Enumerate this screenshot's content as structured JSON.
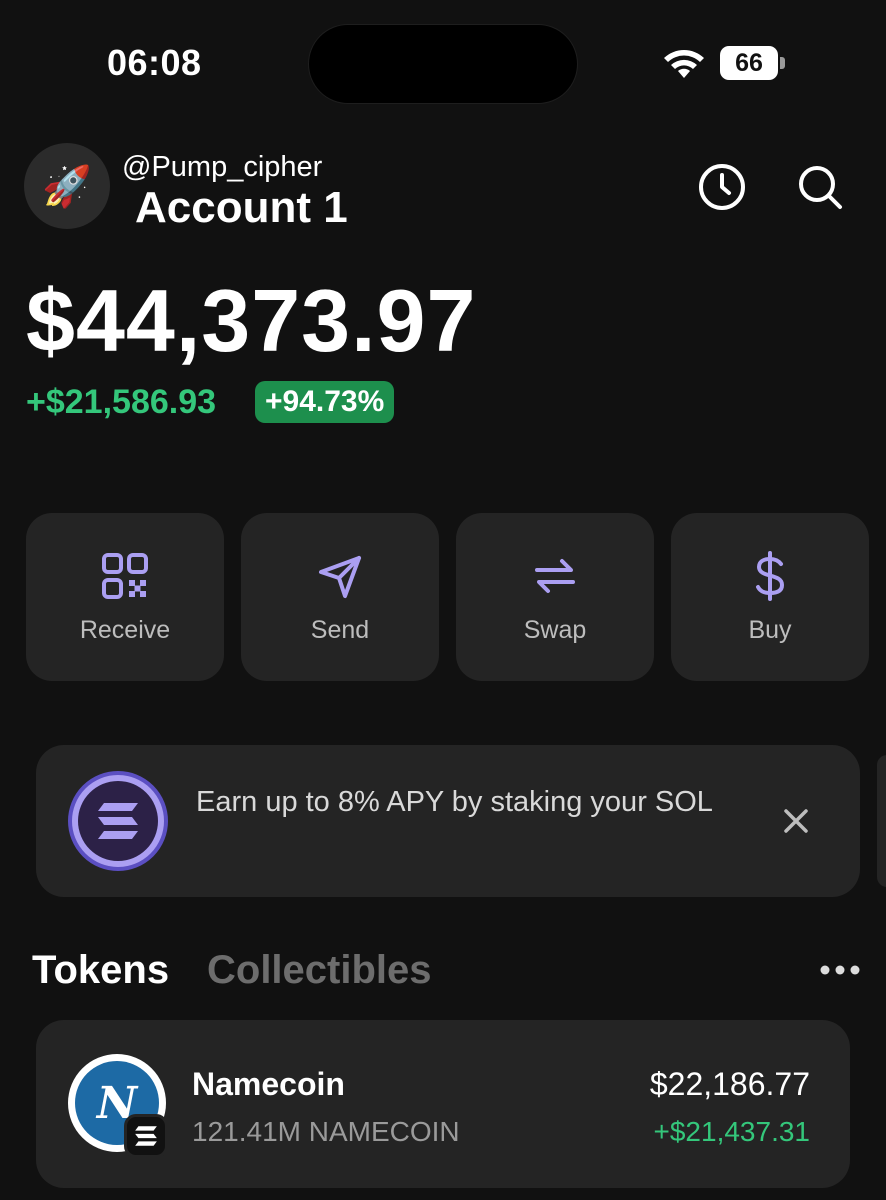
{
  "status_bar": {
    "time": "06:08",
    "battery": "66"
  },
  "header": {
    "handle": "@Pump_cipher",
    "account": "Account 1",
    "avatar_emoji": "🚀"
  },
  "balance": {
    "total": "$44,373.97",
    "change_abs": "+$21,586.93",
    "change_pct": "+94.73%"
  },
  "actions": [
    {
      "label": "Receive",
      "icon": "qr-code-icon"
    },
    {
      "label": "Send",
      "icon": "send-icon"
    },
    {
      "label": "Swap",
      "icon": "swap-icon"
    },
    {
      "label": "Buy",
      "icon": "dollar-icon"
    }
  ],
  "banner": {
    "text": "Earn up to 8% APY by staking your SOL"
  },
  "tabs": {
    "tokens": "Tokens",
    "collectibles": "Collectibles"
  },
  "tokens": [
    {
      "name": "Namecoin",
      "amount": "121.41M NAMECOIN",
      "value": "$22,186.77",
      "change": "+$21,437.31"
    }
  ],
  "colors": {
    "accent": "#ab9ff2",
    "positive": "#34c77b",
    "positive_badge": "#1d8f4d",
    "card": "#242424",
    "background": "#111111"
  }
}
